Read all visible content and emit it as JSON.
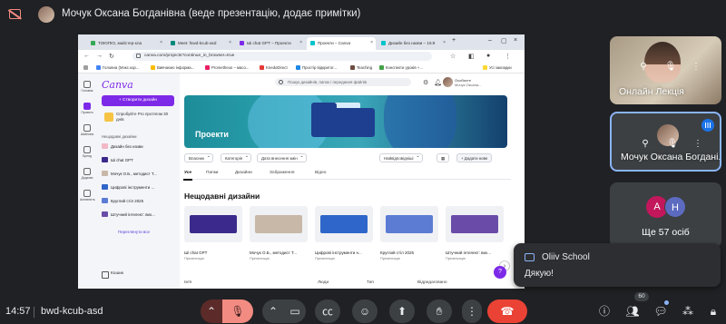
{
  "top_bar": {
    "presenter_label": "Мочук Оксана Богданівна (веде презентацію, додає примітки)"
  },
  "browser": {
    "tabs": [
      {
        "label": "ТОЮПІО, майстер-кла",
        "color": "#34a853"
      },
      {
        "label": "Meet: fswd-kcub-asd",
        "color": "#00897b"
      },
      {
        "label": "Ші chat GPT – Проекти",
        "color": "#7d2ae8"
      },
      {
        "label": "Проекти – Canva",
        "color": "#00c4cc",
        "active": true
      },
      {
        "label": "Дизайн без назви – 16:9",
        "color": "#00c4cc"
      }
    ],
    "url": "canva.com/projects?continue_in_browser=true",
    "bookmarks": [
      {
        "label": "Головна (Мэкс.кор...",
        "color": "#4285f4"
      },
      {
        "label": "Вивчаємо інформа...",
        "color": "#fbbc04"
      },
      {
        "label": "Prometheus – масо...",
        "color": "#e91e63"
      },
      {
        "label": "KnedoDirect",
        "color": "#e53935"
      },
      {
        "label": "Простір відкритої...",
        "color": "#1e88e5"
      },
      {
        "label": "Teaching",
        "color": "#6d4c41"
      },
      {
        "label": "Конспекти уроків +...",
        "color": "#43a047"
      },
      {
        "label": "Усі закладки",
        "color": "#fdd835"
      }
    ]
  },
  "canva": {
    "logo": "Canva",
    "rail": [
      "Головна",
      "Проекти",
      "Шаблони",
      "Бренд",
      "Додатки",
      "Активність"
    ],
    "create_button": "+ Створити дизайн",
    "pro_promo": "Спробуйте Pro протягом 30 днів",
    "recent_heading": "Нещодавні дизайни",
    "recent_list": [
      {
        "label": "Дизайн без назви",
        "color": "#f2b8c6"
      },
      {
        "label": "Ші chat GPT",
        "color": "#3b2a8c"
      },
      {
        "label": "Мочук О.Б., методист Т...",
        "color": "#c7b8a7"
      },
      {
        "label": "Цифрові інструменти ...",
        "color": "#2f66c9"
      },
      {
        "label": "Круглий стіл 2025",
        "color": "#5c7cd4"
      },
      {
        "label": "Штучний інтелект: вих...",
        "color": "#6a4ca8"
      }
    ],
    "show_all": "Переглянути все",
    "trash": "Кошик",
    "search_placeholder": "Пошук дизайнів, папок і передання файлів",
    "user": {
      "name": "Особисте",
      "subtitle": "Мочук Оксана..."
    },
    "banner_title": "Проекти",
    "filters": [
      "Власник",
      "Категорія",
      "Дата внесення змін"
    ],
    "sort_label": "Найвідповідніші",
    "add_new": "+ Додати нове",
    "subtabs": [
      "Усе",
      "Папки",
      "Дизайни",
      "Зображення",
      "Відео"
    ],
    "section_title": "Нещодавні дизайни",
    "cards": [
      {
        "name": "Ші chat GPT",
        "type": "Презентація",
        "color": "#3b2a8c"
      },
      {
        "name": "Мочук О.Б., методист Т...",
        "type": "Презентація",
        "color": "#c7b8a7"
      },
      {
        "name": "Цифрові інструменти н...",
        "type": "Презентація",
        "color": "#2f66c9"
      },
      {
        "name": "Круглий стіл 2025",
        "type": "Презентація",
        "color": "#5c7cd4"
      },
      {
        "name": "Штучний інтелект: вих...",
        "type": "Презентація",
        "color": "#6a4ca8"
      }
    ],
    "list_columns": [
      "Ім'я",
      "Люди",
      "Тип",
      "Відредаговано"
    ]
  },
  "participants": [
    {
      "name": "Онлайн Лекція"
    },
    {
      "name": "Мочук Оксана Богдані..."
    },
    {
      "avatars": [
        "А",
        "Н"
      ],
      "more": "Ще 57 осіб"
    }
  ],
  "chat_toast": {
    "sender": "Oliiv School",
    "message": "Дякую!"
  },
  "bottom_bar": {
    "time": "14:57",
    "meeting_code": "bwd-kcub-asd",
    "people_count": "60"
  },
  "colors": {
    "meet_bg": "#202124",
    "canva_purple": "#7d2ae8",
    "mic_off": "#f28b82",
    "hangup": "#ea4335"
  }
}
